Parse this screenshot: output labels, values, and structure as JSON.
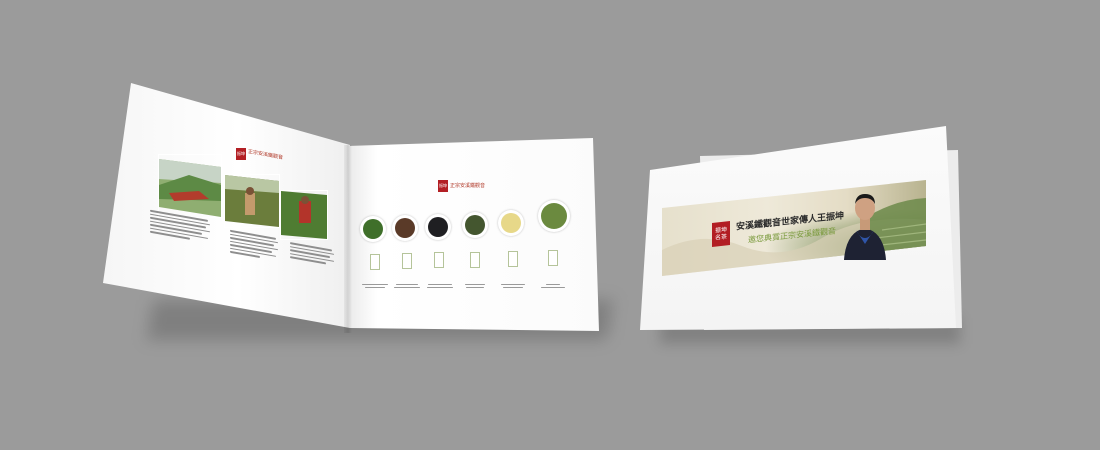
{
  "left_page": {
    "seal_lines": [
      "振坤",
      "名茶"
    ],
    "title": "正宗安溪鐵觀音"
  },
  "right_page": {
    "seal_lines": [
      "振坤",
      "名茶"
    ],
    "title": "正宗安溪鐵觀音",
    "tea_colors": [
      "#3f6f2a",
      "#5a3a28",
      "#1f1f22",
      "#44562f",
      "#e7d889",
      "#6b8a3f"
    ]
  },
  "card": {
    "seal_lines": [
      "振坤",
      "名茶"
    ],
    "title": "安溪鐵觀音世家傳人王振坤",
    "subtitle": "邀您典賞正宗安溪鐵觀音"
  },
  "colors": {
    "background": "#9b9b9b",
    "seal_red": "#b21e23",
    "green_accent": "#7a9a3c"
  }
}
